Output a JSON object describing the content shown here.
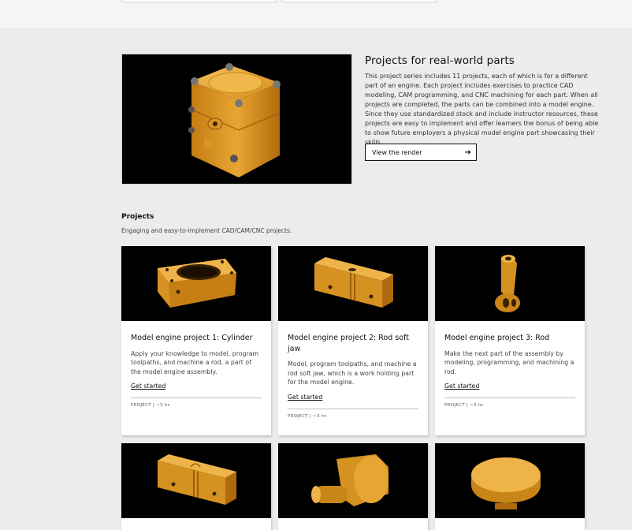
{
  "hero": {
    "title": "Projects for real-world parts",
    "description": "This project series includes 11 projects, each of which is for a different part of an engine. Each project includes exercises to practice CAD modeling, CAM programming, and CNC machining for each part. When all projects are completed, the parts can be combined into a model engine. Since they use standardized stock and include instructor resources, these projects are easy to implement and offer learners the bonus of being able to show future employers a physical model engine part showcasing their skills.",
    "button_label": "View the render",
    "button_icon": "arrow-right-icon"
  },
  "projects_section": {
    "title": "Projects",
    "subtitle": "Engaging and easy-to-implement CAD/CAM/CNC projects."
  },
  "cards": [
    {
      "title": "Model engine project 1: Cylinder",
      "description": "Apply your knowledge to model, program toolpaths, and machine a rod, a part of the model engine assembly.",
      "link": "Get started",
      "meta": "PROJECT | ~3 hr."
    },
    {
      "title": "Model engine project 2: Rod soft jaw",
      "description": "Model, program toolpaths, and machine a rod soft jaw, which is a work holding part for the model engine.",
      "link": "Get started",
      "meta": "PROJECT | ~3 hr."
    },
    {
      "title": "Model engine project 3: Rod",
      "description": "Make the next part of the assembly by modeling, programming, and machining a rod.",
      "link": "Get started",
      "meta": "PROJECT | ~3 hr."
    }
  ],
  "colors": {
    "part_gold": "#e3a02c",
    "thumb_background": "#000000",
    "page_background": "#ececec"
  }
}
